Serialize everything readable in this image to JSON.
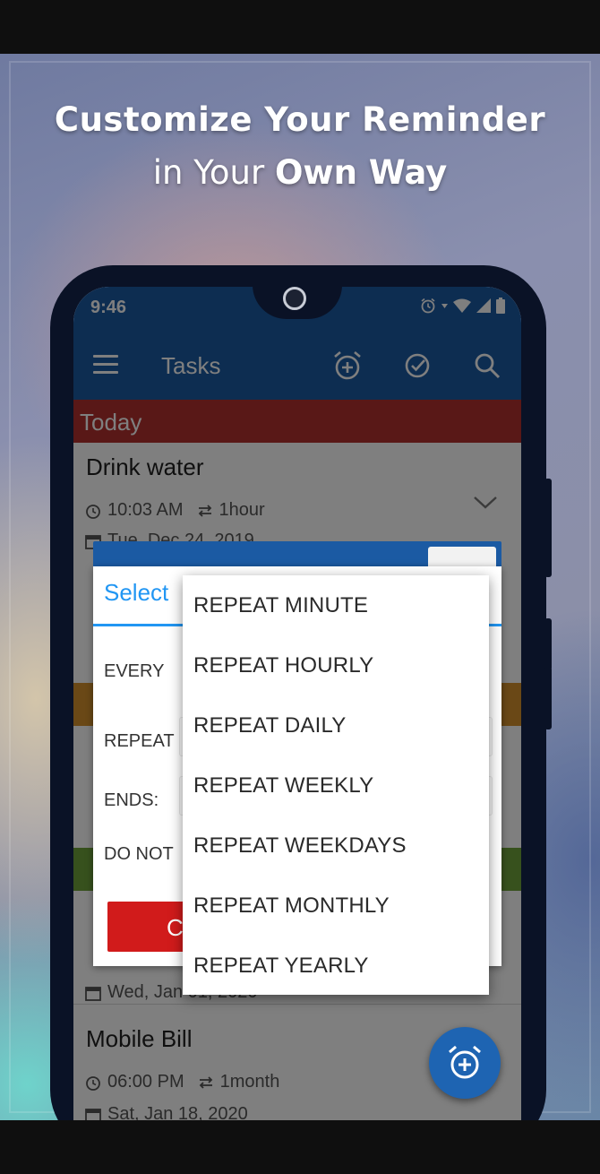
{
  "headline": {
    "line1": "Customize Your Reminder",
    "line2_prefix": "in Your",
    "line2_bold": "Own Way"
  },
  "status_bar": {
    "time": "9:46"
  },
  "app_bar": {
    "title": "Tasks"
  },
  "sections": {
    "today": "Today"
  },
  "tasks": [
    {
      "title": "Drink water",
      "time": "10:03 AM",
      "repeat": "1hour",
      "date": "Tue, Dec 24, 2019"
    },
    {
      "date": "Wed, Jan 01, 2020"
    },
    {
      "title": "Mobile Bill",
      "time": "06:00 PM",
      "repeat": "1month",
      "date": "Sat, Jan 18, 2020"
    }
  ],
  "dialog": {
    "title": "Select",
    "labels": {
      "every": "EVERY",
      "repeat": "REPEAT",
      "ends": "ENDS:",
      "do_not": "DO NOT"
    },
    "button_label": "C"
  },
  "dropdown": {
    "items": [
      "REPEAT MINUTE",
      "REPEAT HOURLY",
      "REPEAT DAILY",
      "REPEAT WEEKLY",
      "REPEAT WEEKDAYS",
      "REPEAT MONTHLY",
      "REPEAT YEARLY"
    ]
  },
  "colors": {
    "primary": "#1b5aa3",
    "today_header": "#b3302f",
    "tomorrow_header": "#d4902d",
    "upcoming_header": "#6ea33a",
    "accent": "#2196f3",
    "danger": "#d11b1b"
  },
  "icons": [
    "menu-icon",
    "add-alarm-icon",
    "check-circle-icon",
    "search-icon",
    "alarm-icon",
    "wifi-icon",
    "signal-icon",
    "battery-icon",
    "clock-icon",
    "repeat-icon",
    "calendar-icon",
    "chevron-down-icon",
    "add-alarm-fab-icon"
  ]
}
